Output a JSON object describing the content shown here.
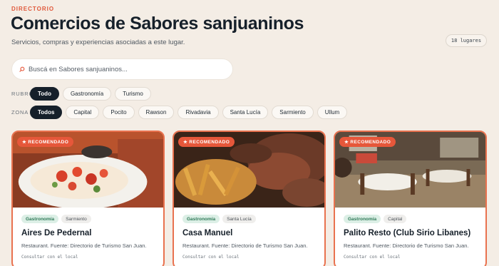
{
  "header": {
    "eyebrow": "DIRECTORIO",
    "title": "Comercios de Sabores sanjuaninos",
    "subtitle": "Servicios, compras y experiencias asociadas a este lugar.",
    "count": "18 lugares"
  },
  "search": {
    "placeholder": "Buscá en Sabores sanjuaninos..."
  },
  "filters": {
    "rubro": {
      "label": "RUBRO",
      "options": [
        "Todo",
        "Gastronomía",
        "Turismo"
      ],
      "selected": "Todo"
    },
    "zona": {
      "label": "ZONA",
      "options": [
        "Todos",
        "Capital",
        "Pocito",
        "Rawson",
        "Rivadavia",
        "Santa Lucía",
        "Sarmiento",
        "Ullum"
      ],
      "selected": "Todos"
    }
  },
  "cards": [
    {
      "badge": "★ RECOMENDADO",
      "category": "Gastronomía",
      "zone": "Sarmiento",
      "name": "Aires De Pedernal",
      "description": "Restaurant. Fuente: Directorio de Turismo San Juan.",
      "contact": "Consultar con el local"
    },
    {
      "badge": "★ RECOMENDADO",
      "category": "Gastronomía",
      "zone": "Santa Lucía",
      "name": "Casa Manuel",
      "description": "Restaurant. Fuente: Directorio de Turismo San Juan.",
      "contact": "Consultar con el local"
    },
    {
      "badge": "★ RECOMENDADO",
      "category": "Gastronomía",
      "zone": "Capital",
      "name": "Palito Resto (Club Sirio Libanes)",
      "description": "Restaurant. Fuente: Directorio de Turismo San Juan.",
      "contact": "Consultar con el local"
    }
  ],
  "colors": {
    "background": "#f4ede5",
    "accent": "#e6573a",
    "dark": "#16202a",
    "category_tag": "#dcefe6"
  },
  "icons": {
    "search": "search-icon"
  }
}
